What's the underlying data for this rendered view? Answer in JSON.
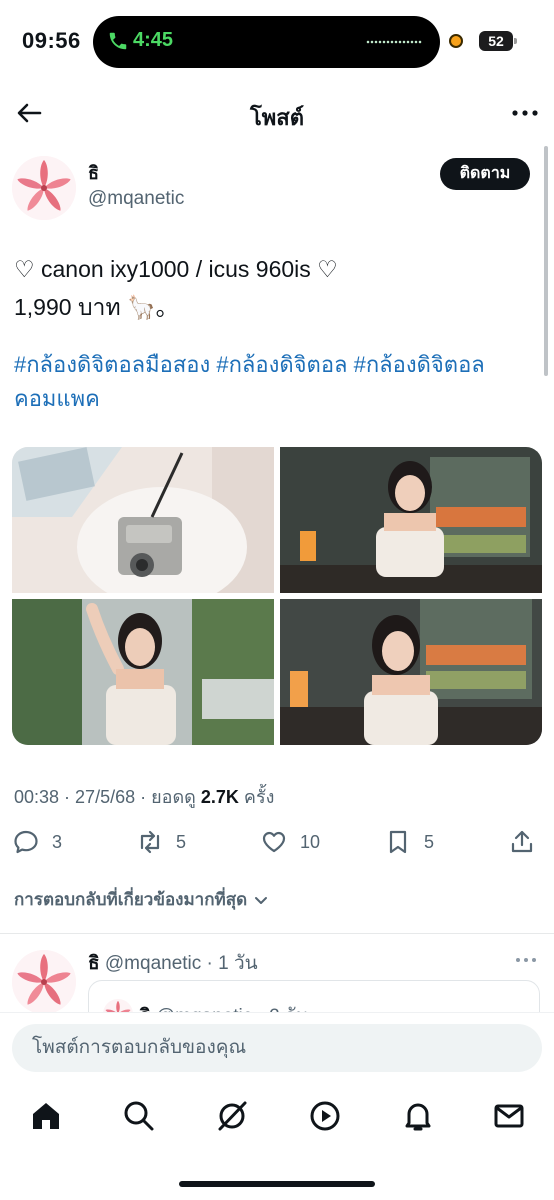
{
  "status_bar": {
    "time": "09:56",
    "call_timer": "4:45",
    "battery": "52"
  },
  "header": {
    "title": "โพสต์"
  },
  "author": {
    "name": "ธิ",
    "handle": "@mqanetic",
    "follow_label": "ติดตาม"
  },
  "post": {
    "line1": "♡ canon ixy1000 / icus 960is ♡",
    "line2": "1,990 บาท 🦙。",
    "hashtags": "#กล้องดิจิตอลมือสอง #กล้องดิจิตอล #กล้องดิจิตอลคอมแพค"
  },
  "meta": {
    "time": "00:38",
    "date": "27/5/68",
    "views_label": "ยอดดู",
    "views": "2.7K",
    "views_suffix": "ครั้ง"
  },
  "actions": {
    "replies": "3",
    "reposts": "5",
    "likes": "10",
    "bookmarks": "5"
  },
  "replies_filter": {
    "label": "การตอบกลับที่เกี่ยวข้องมากที่สุด"
  },
  "reply": {
    "name": "ธิ",
    "handle": "@mqanetic",
    "age": "1 วัน",
    "quoted_name": "ธิ",
    "quoted_handle": "@mqanetic",
    "quoted_age": "2 วัน"
  },
  "composer": {
    "placeholder": "โพสต์การตอบกลับของคุณ"
  },
  "tabbar": {
    "icons": [
      "home-icon",
      "search-icon",
      "grok-icon",
      "video-icon",
      "notifications-icon",
      "messages-icon"
    ]
  },
  "colors": {
    "accent": "#1d6fb8",
    "text": "#0f1419",
    "secondary": "#536471",
    "call_green": "#4cd964"
  }
}
